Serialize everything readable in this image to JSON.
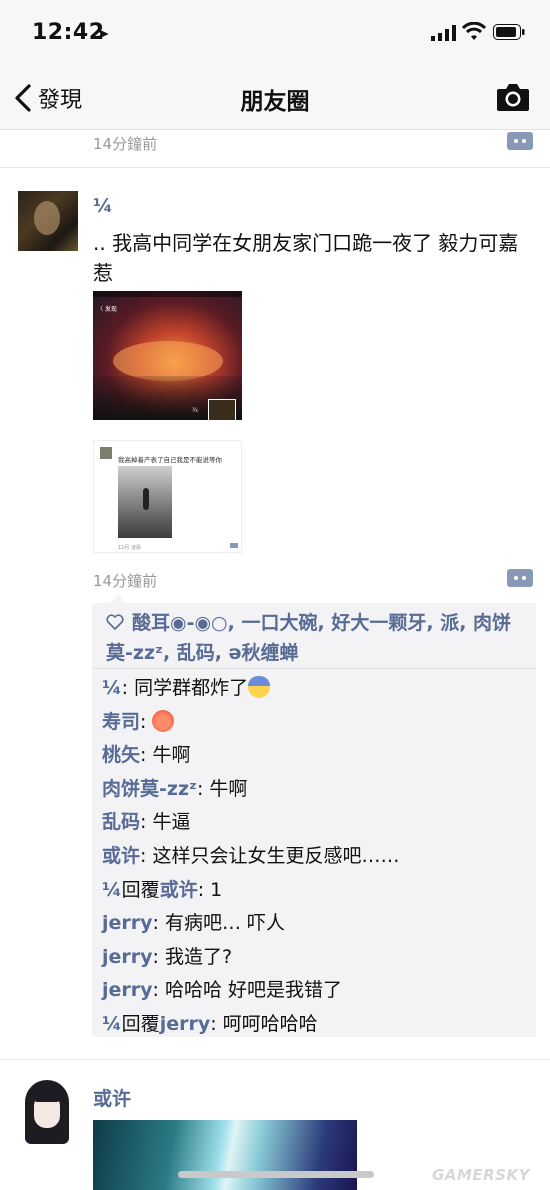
{
  "status_bar": {
    "time": "12:42",
    "location_icon": "location-arrow-icon",
    "signal_icon": "cellular-signal-icon",
    "wifi_icon": "wifi-icon",
    "battery_icon": "battery-icon"
  },
  "nav": {
    "back_label": "發現",
    "title": "朋友圈",
    "camera_icon": "camera-icon"
  },
  "previous_post": {
    "time": "14分鐘前"
  },
  "post1": {
    "author": "¼",
    "text": ".. 我高中同学在女朋友家门口跪一夜了 毅力可嘉惹",
    "image1": {
      "back_label": "〈 发现",
      "poster": "¼"
    },
    "image2": {
      "text": "我高掉着产表了自己我是不能说等你",
      "footer": "12月 凌晨"
    },
    "time": "14分鐘前",
    "likes": [
      "酸耳◉-◉○",
      "一口大碗",
      "好大一颗牙",
      "派",
      "肉饼莫-zzᶻ",
      "乱码",
      "ə秋缠蝉"
    ],
    "comments": [
      {
        "name": "¼",
        "reply_to": "",
        "text": "同学群都炸了",
        "emoji": "fearful-face"
      },
      {
        "name": "寿司",
        "reply_to": "",
        "text": "",
        "emoji": "angry-face"
      },
      {
        "name": "桃矢",
        "reply_to": "",
        "text": "牛啊",
        "emoji": ""
      },
      {
        "name": "肉饼莫-zzᶻ",
        "reply_to": "",
        "text": "牛啊",
        "emoji": ""
      },
      {
        "name": "乱码",
        "reply_to": "",
        "text": "牛逼",
        "emoji": ""
      },
      {
        "name": "或许",
        "reply_to": "",
        "text": "这样只会让女生更反感吧……",
        "emoji": ""
      },
      {
        "name": "¼",
        "reply_word": "回覆",
        "reply_to": "或许",
        "text": "1",
        "emoji": ""
      },
      {
        "name": "jerry",
        "reply_to": "",
        "text": "有病吧… 吓人",
        "emoji": ""
      },
      {
        "name": "jerry",
        "reply_to": "",
        "text": "我造了?",
        "emoji": ""
      },
      {
        "name": "jerry",
        "reply_to": "",
        "text": "哈哈哈 好吧是我错了",
        "emoji": ""
      },
      {
        "name": "¼",
        "reply_word": "回覆",
        "reply_to": "jerry",
        "text": "呵呵哈哈哈",
        "emoji": ""
      }
    ]
  },
  "post2": {
    "author": "或许"
  },
  "watermark": "GAMERSKY"
}
